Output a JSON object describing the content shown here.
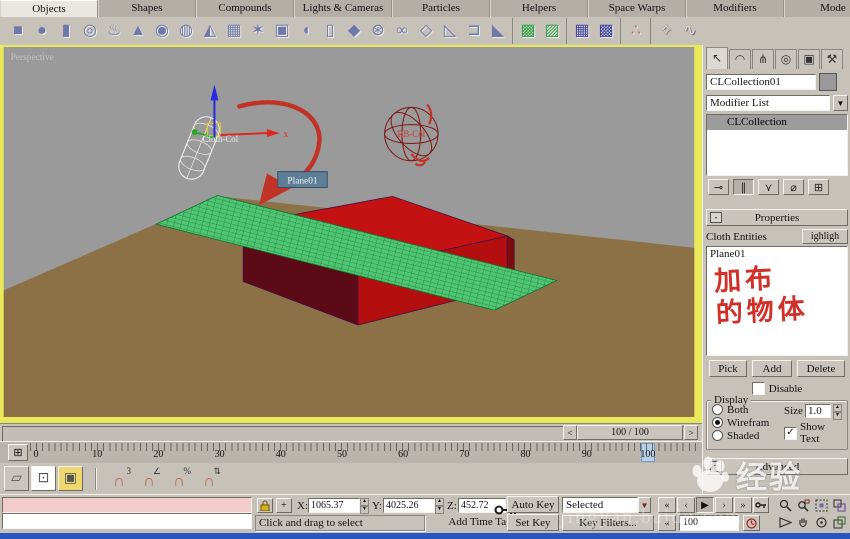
{
  "colors": {
    "viewport_border": "#e9e95a",
    "viewport_bg": "#9a9a9a",
    "floor": "#8d7146",
    "box_top": "#c41212",
    "box_front": "#b30f0f",
    "box_left": "#5c0a16",
    "cloth_green": "#52c878",
    "annotation_red": "#c23226",
    "taskbar_blue": "#2b55c0",
    "chrome": "#c6c2ba"
  },
  "tab_bar": {
    "tabs": [
      {
        "label": "Objects",
        "cls": "tab active",
        "name": "tab-objects"
      },
      {
        "label": "Shapes",
        "cls": "tab",
        "name": "tab-shapes"
      },
      {
        "label": "Compounds",
        "cls": "tab",
        "name": "tab-compounds"
      },
      {
        "label": "Lights & Cameras",
        "cls": "tab",
        "name": "tab-lights-cameras"
      },
      {
        "label": "Particles",
        "cls": "tab",
        "name": "tab-particles"
      },
      {
        "label": "Helpers",
        "cls": "tab",
        "name": "tab-helpers"
      },
      {
        "label": "Space Warps",
        "cls": "tab",
        "name": "tab-space-warps"
      },
      {
        "label": "Modifiers",
        "cls": "tab",
        "name": "tab-modifiers"
      },
      {
        "label": "Mode",
        "cls": "tab",
        "name": "tab-modeling"
      }
    ]
  },
  "object_toolbar": {
    "icons": [
      {
        "name": "box-icon",
        "glyph": "■",
        "cls": "ticon"
      },
      {
        "name": "sphere-icon",
        "glyph": "●",
        "cls": "ticon"
      },
      {
        "name": "cylinder-icon",
        "glyph": "▮",
        "cls": "ticon"
      },
      {
        "name": "torus-icon",
        "glyph": "◎",
        "cls": "ticon"
      },
      {
        "name": "teapot-icon",
        "glyph": "♨",
        "cls": "ticon"
      },
      {
        "name": "cone-icon",
        "glyph": "▲",
        "cls": "ticon"
      },
      {
        "name": "geosphere-icon",
        "glyph": "◉",
        "cls": "ticon"
      },
      {
        "name": "tube-icon",
        "glyph": "◍",
        "cls": "ticon"
      },
      {
        "name": "pyramid-icon",
        "glyph": "◭",
        "cls": "ticon"
      },
      {
        "name": "plane-icon",
        "glyph": "▦",
        "cls": "ticon"
      },
      {
        "name": "hedra-icon",
        "glyph": "✶",
        "cls": "ticon"
      },
      {
        "name": "chamfer-box-icon",
        "glyph": "▣",
        "cls": "ticon"
      },
      {
        "name": "capsule-icon",
        "glyph": "◖",
        "cls": "ticon"
      },
      {
        "name": "oil-tank-icon",
        "glyph": "▯",
        "cls": "ticon"
      },
      {
        "name": "spindle-icon",
        "glyph": "◆",
        "cls": "ticon"
      },
      {
        "name": "ringwave-icon",
        "glyph": "⊛",
        "cls": "ticon"
      },
      {
        "name": "torus-knot-icon",
        "glyph": "∞",
        "cls": "ticon"
      },
      {
        "name": "gengon-icon",
        "glyph": "◇",
        "cls": "ticon"
      },
      {
        "name": "l-ext-icon",
        "glyph": "◺",
        "cls": "ticon"
      },
      {
        "name": "c-ext-icon",
        "glyph": "⊐",
        "cls": "ticon"
      },
      {
        "name": "prism-icon",
        "glyph": "◣",
        "cls": "ticon grp-end"
      },
      {
        "name": "quad-patch-icon",
        "glyph": "▩",
        "cls": "ticon green"
      },
      {
        "name": "tri-patch-icon",
        "glyph": "▨",
        "cls": "ticon green grp-end"
      },
      {
        "name": "nurbs-surface-icon",
        "glyph": "▦",
        "cls": "ticon navy"
      },
      {
        "name": "nurbs-cv-surface-icon",
        "glyph": "▩",
        "cls": "ticon navy grp-end"
      },
      {
        "name": "point-helper-icon",
        "glyph": "∴",
        "cls": "ticon pink grp-end"
      },
      {
        "name": "bone-icon",
        "glyph": "✧",
        "cls": "ticon lite"
      },
      {
        "name": "spring-icon",
        "glyph": "∿",
        "cls": "ticon lite"
      }
    ]
  },
  "viewport": {
    "view_label": "Perspective",
    "object_labels": {
      "cloth_col": "Cloth-Col",
      "rb_col": "RB-Col",
      "plane_tooltip": "Plane01"
    },
    "gizmo_axis_label": "x"
  },
  "command_panel": {
    "tabs": [
      {
        "name": "select-tab",
        "glyph": "↖",
        "cls": "ptab active"
      },
      {
        "name": "modify-tab",
        "glyph": "◠",
        "cls": "ptab"
      },
      {
        "name": "hierarchy-tab",
        "glyph": "⋔",
        "cls": "ptab"
      },
      {
        "name": "motion-tab",
        "glyph": "◎",
        "cls": "ptab"
      },
      {
        "name": "display-tab",
        "glyph": "▣",
        "cls": "ptab"
      },
      {
        "name": "utilities-tab",
        "glyph": "⚒",
        "cls": "ptab"
      }
    ],
    "object_name": "CLCollection01",
    "modifier_list_label": "Modifier List",
    "stack_items": [
      {
        "label": "CLCollection",
        "cls": "stackrow sel"
      }
    ],
    "stack_buttons": [
      {
        "name": "pin-stack-icon",
        "glyph": "⊸",
        "cls": "sbtn btn"
      },
      {
        "name": "show-end-result-icon",
        "glyph": "∥",
        "cls": "sbtn btn pressed"
      },
      {
        "name": "make-unique-icon",
        "glyph": "⋎",
        "cls": "sbtn btn"
      },
      {
        "name": "remove-modifier-icon",
        "glyph": "⌀",
        "cls": "sbtn btn"
      },
      {
        "name": "configure-modifier-sets-icon",
        "glyph": "⊞",
        "cls": "sbtn btn"
      }
    ],
    "properties": {
      "collapse_glyph": "-",
      "title": "Properties",
      "cloth_entities_label": "Cloth Entities",
      "highlight_button": "ighligh",
      "entities": [
        "Plane01"
      ],
      "pick_button": "Pick",
      "add_button": "Add",
      "delete_button": "Delete",
      "disable_label": "Disable",
      "display_group": {
        "title": "Display",
        "radios": [
          {
            "label": "Both",
            "cls": "radio",
            "name": "display-both-radio"
          },
          {
            "label": "Wirefram",
            "cls": "radio on",
            "name": "display-wireframe-radio"
          },
          {
            "label": "Shaded",
            "cls": "radio",
            "name": "display-shaded-radio"
          }
        ],
        "size_label": "Size",
        "size_value": "1.0",
        "show_text_label_1": "Show",
        "show_text_label_2": "Text",
        "show_text_checked": true
      }
    },
    "advanced": {
      "collapse_glyph": "+",
      "title": "Advanced"
    },
    "annotation": {
      "line1": "加布",
      "line2": "的物体"
    }
  },
  "timeline": {
    "slider_value": "100 / 100",
    "prev_arrow": "<",
    "next_arrow": ">",
    "curve_editor_glyph": "⊞",
    "ruler_numbers": [
      "0",
      "10",
      "20",
      "30",
      "40",
      "50",
      "60",
      "70",
      "80",
      "90",
      "100"
    ],
    "current_frame": "100"
  },
  "snap_row": {
    "toggles": [
      {
        "name": "mirror-tool-icon",
        "glyph": "▱",
        "cls": "snbtn btn"
      },
      {
        "name": "selection-region-icon",
        "glyph": "⊡",
        "cls": "snbtn btn on-white"
      },
      {
        "name": "snap-mode-icon",
        "glyph": "▣",
        "cls": "snbtn btn on-yellow"
      }
    ],
    "magnets": [
      {
        "name": "snap-toggle-3d",
        "sup": "3"
      },
      {
        "name": "angle-snap-toggle",
        "sup": "∠"
      },
      {
        "name": "percent-snap-toggle",
        "sup": "%"
      },
      {
        "name": "spinner-snap-toggle",
        "sup": "⇅"
      }
    ]
  },
  "status_bar": {
    "prompt": "Click and drag to select",
    "add_time_tag": "Add Time Tag",
    "coords": {
      "x_label": "X:",
      "x_value": "1065.37",
      "y_label": "Y:",
      "y_value": "4025.26",
      "z_label": "Z:",
      "z_value": "452.72"
    },
    "auto_key": "Auto Key",
    "set_key": "Set Key",
    "selected_dropdown": "Selected",
    "dropdown_arrow": "▼",
    "key_filters": "Key Filters...",
    "frame_field": "100",
    "transport": [
      {
        "name": "go-to-start-button",
        "glyph": "«",
        "cls": "tbtn btn"
      },
      {
        "name": "previous-frame-button",
        "glyph": "‹",
        "cls": "tbtn btn"
      },
      {
        "name": "play-button",
        "glyph": "▶",
        "cls": "tbtn btn pressed"
      },
      {
        "name": "next-frame-button",
        "glyph": "›",
        "cls": "tbtn btn"
      },
      {
        "name": "go-to-end-button",
        "glyph": "»",
        "cls": "tbtn btn"
      }
    ],
    "go_to_start_glyph": "«"
  },
  "watermark": {
    "brand": "经验",
    "url": "jingyan.baidu.com"
  }
}
